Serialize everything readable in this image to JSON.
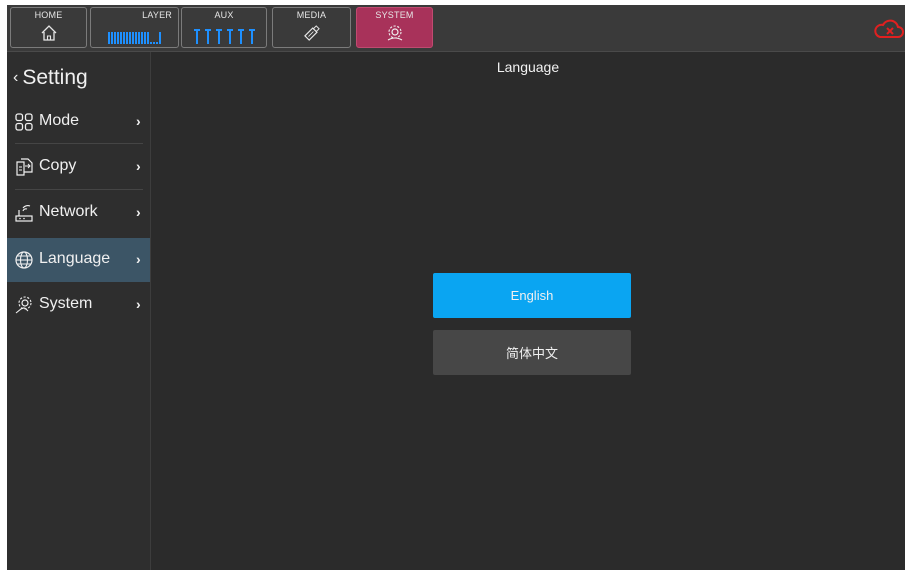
{
  "colors": {
    "accent_blue": "#0aa5f2",
    "system_tab_active": "#a8325a",
    "sidebar_active": "#3c5566",
    "cloud_alert": "#e02020",
    "background": "#2b2b2b"
  },
  "top_tabs": [
    {
      "label": "HOME",
      "icon": "home-icon"
    },
    {
      "label": "LAYER",
      "icon": "layer-levels-icon"
    },
    {
      "label": "AUX",
      "icon": "aux-levels-icon"
    },
    {
      "label": "MEDIA",
      "icon": "usb-drive-icon"
    },
    {
      "label": "SYSTEM",
      "icon": "system-gear-icon",
      "active": true
    }
  ],
  "status": {
    "cloud_icon": "cloud-disconnected-icon"
  },
  "sidebar": {
    "back_label": "Setting",
    "items": [
      {
        "label": "Mode",
        "icon": "mode-grid-icon"
      },
      {
        "label": "Copy",
        "icon": "copy-icon"
      },
      {
        "label": "Network",
        "icon": "network-icon"
      },
      {
        "label": "Language",
        "icon": "globe-icon",
        "active": true
      },
      {
        "label": "System",
        "icon": "system-gear-icon"
      }
    ]
  },
  "main": {
    "title": "Language",
    "options": [
      {
        "label": "English",
        "selected": true
      },
      {
        "label": "简体中文",
        "selected": false
      }
    ]
  }
}
